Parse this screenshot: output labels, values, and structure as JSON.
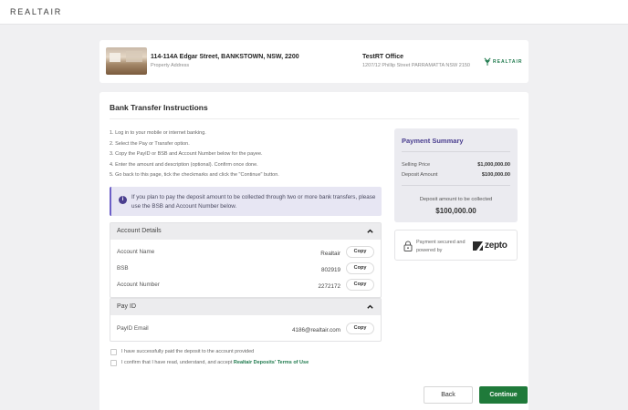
{
  "header": {
    "logo": "REALTAIR"
  },
  "property": {
    "address": "114-114A Edgar Street, BANKSTOWN, NSW, 2200",
    "address_caption": "Property Address",
    "office_name": "TestRT Office",
    "office_address": "1207/12 Phillip Street PARRAMATTA NSW 2150",
    "brand": "REALTAIR"
  },
  "instructions": {
    "title": "Bank Transfer Instructions",
    "steps": [
      "1. Log in to your mobile or internet banking.",
      "2. Select the Pay or Transfer option.",
      "3. Copy the PayID or BSB and Account Number below for the payee.",
      "4. Enter the amount and description (optional). Confirm once done.",
      "5. Go back to this page, tick the checkmarks and click the \"Continue\" button."
    ],
    "notice": "If you plan to pay the deposit amount to be collected through two or more bank transfers, please use the BSB and Account Number below."
  },
  "account_details": {
    "title": "Account Details",
    "rows": [
      {
        "label": "Account Name",
        "value": "Realtair",
        "copy": "Copy"
      },
      {
        "label": "BSB",
        "value": "802919",
        "copy": "Copy"
      },
      {
        "label": "Account Number",
        "value": "2272172",
        "copy": "Copy"
      }
    ]
  },
  "pay_id": {
    "title": "Pay ID",
    "rows": [
      {
        "label": "PayID Email",
        "value": "4186@realtair.com",
        "copy": "Copy"
      }
    ]
  },
  "confirmations": {
    "paid": "I have successfully paid the deposit to the account provided",
    "terms_prefix": "I confirm that I have read, understand, and accept ",
    "terms_link": "Realtair Deposits' Terms of Use"
  },
  "summary": {
    "title": "Payment Summary",
    "selling_price_label": "Selling Price",
    "selling_price": "$1,000,000.00",
    "deposit_label": "Deposit Amount",
    "deposit": "$100,000.00",
    "collected_caption": "Deposit amount to be collected",
    "collected_total": "$100,000.00"
  },
  "secure": {
    "text": "Payment secured and powered by",
    "provider": "zepto"
  },
  "actions": {
    "back": "Back",
    "continue": "Continue"
  },
  "colors": {
    "accent_green": "#1f7a3a",
    "accent_purple": "#4a3e8f"
  }
}
